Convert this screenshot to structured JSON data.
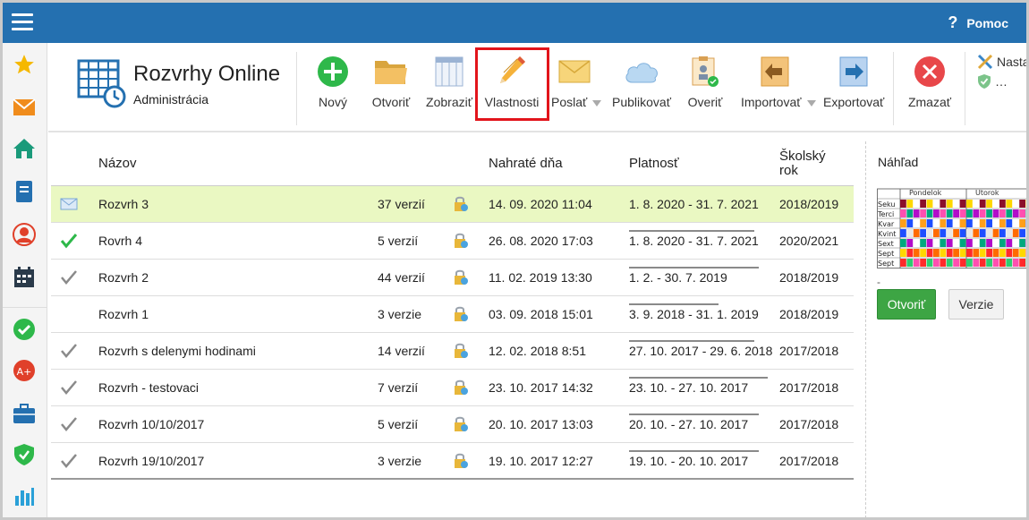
{
  "topbar": {
    "help_label": "Pomoc",
    "help_glyph": "?"
  },
  "app": {
    "title": "Rozvrhy Online",
    "subtitle": "Administrácia"
  },
  "toolbar": {
    "new": "Nový",
    "open": "Otvoriť",
    "view": "Zobraziť",
    "properties": "Vlastnosti",
    "send": "Poslať",
    "publish": "Publikovať",
    "verify": "Overiť",
    "import": "Importovať",
    "export": "Exportovať",
    "delete": "Zmazať",
    "settings": "Nasta",
    "more": "…"
  },
  "table": {
    "headers": {
      "name": "Názov",
      "uploaded": "Nahraté dňa",
      "validity": "Platnosť",
      "year_line1": "Školský",
      "year_line2": "rok"
    },
    "rows": [
      {
        "status": "mail",
        "name": "Rozvrh 3",
        "versions": "37 verzií",
        "uploaded": "14. 09. 2020 11:04",
        "validity": "1. 8. 2020 - 31. 7. 2021",
        "year": "2018/2019",
        "selected": true
      },
      {
        "status": "check-green",
        "name": "Rovrh 4",
        "versions": "5 verzií",
        "uploaded": "26. 08. 2020 17:03",
        "validity": "1. 8. 2020 - 31. 7. 2021",
        "year": "2020/2021"
      },
      {
        "status": "check-gray",
        "name": "Rozvrh 2",
        "versions": "44 verzií",
        "uploaded": "11. 02. 2019 13:30",
        "validity": "1. 2. - 30. 7. 2019",
        "year": "2018/2019"
      },
      {
        "status": "none",
        "name": "Rozvrh 1",
        "versions": "3 verzie",
        "uploaded": "03. 09. 2018 15:01",
        "validity": "3. 9. 2018 - 31. 1. 2019",
        "year": "2018/2019"
      },
      {
        "status": "check-gray",
        "name": "Rozvrh s delenymi hodinami",
        "versions": "14 verzií",
        "uploaded": "12. 02. 2018 8:51",
        "validity": "27. 10. 2017 - 29. 6. 2018",
        "year": "2017/2018"
      },
      {
        "status": "check-gray",
        "name": "Rozvrh - testovaci",
        "versions": "7 verzií",
        "uploaded": "23. 10. 2017 14:32",
        "validity": "23. 10. - 27. 10. 2017",
        "year": "2017/2018"
      },
      {
        "status": "check-gray",
        "name": "Rozvrh 10/10/2017",
        "versions": "5 verzií",
        "uploaded": "20. 10. 2017 13:03",
        "validity": "20. 10. - 27. 10. 2017",
        "year": "2017/2018"
      },
      {
        "status": "check-gray",
        "name": "Rozvrh 19/10/2017",
        "versions": "3 verzie",
        "uploaded": "19. 10. 2017 12:27",
        "validity": "19. 10. - 20. 10. 2017",
        "year": "2017/2018"
      }
    ]
  },
  "preview": {
    "title": "Náhľad",
    "dash": "-",
    "open_button": "Otvoriť",
    "versions_button": "Verzie",
    "days": [
      "Pondelok",
      "Utorok",
      "S"
    ],
    "classes": [
      "Seku",
      "Terci",
      "Kvar",
      "Kvint",
      "Sext",
      "Sept",
      "Sept"
    ]
  },
  "colors": {
    "topbar": "#2470b0",
    "selected_row": "#eaf8c2",
    "highlight": "#e2141b",
    "open_button": "#3da544"
  }
}
